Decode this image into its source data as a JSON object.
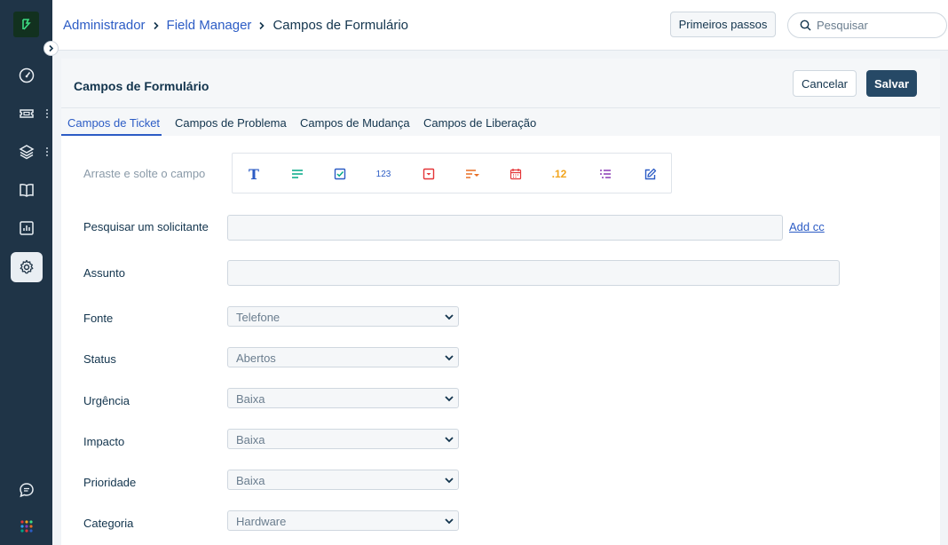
{
  "header": {
    "breadcrumb": [
      "Administrador",
      "Field Manager",
      "Campos de Formulário"
    ],
    "first_steps_label": "Primeiros passos",
    "search_placeholder": "Pesquisar"
  },
  "sidebar": {
    "items": [
      {
        "name": "dashboard",
        "icon": "gauge-icon"
      },
      {
        "name": "tickets",
        "icon": "ticket-icon"
      },
      {
        "name": "assets",
        "icon": "layers-icon"
      },
      {
        "name": "knowledge-base",
        "icon": "book-icon"
      },
      {
        "name": "reports",
        "icon": "bar-chart-icon"
      },
      {
        "name": "admin",
        "icon": "gear-icon",
        "active": true
      }
    ],
    "bottom": [
      {
        "name": "chat",
        "icon": "chat-icon"
      },
      {
        "name": "apps",
        "icon": "apps-grid-icon"
      }
    ]
  },
  "page": {
    "title": "Campos de Formulário",
    "cancel_label": "Cancelar",
    "save_label": "Salvar"
  },
  "tabs": [
    {
      "label": "Campos de Ticket",
      "active": true
    },
    {
      "label": "Campos de Problema"
    },
    {
      "label": "Campos de Mudança"
    },
    {
      "label": "Campos de Liberação"
    }
  ],
  "palette": {
    "label": "Arraste e solte o campo",
    "tools": [
      {
        "icon": "text-icon",
        "glyph": "T",
        "color": "#2c5cc5"
      },
      {
        "icon": "paragraph-icon",
        "color": "#00a886"
      },
      {
        "icon": "checkbox-icon",
        "color": "#2c5cc5"
      },
      {
        "icon": "number-icon",
        "glyph": "123",
        "color": "#2c5cc5"
      },
      {
        "icon": "dropdown-icon",
        "color": "#e43538"
      },
      {
        "icon": "dependent-field-icon",
        "color": "#e86f25"
      },
      {
        "icon": "date-icon",
        "color": "#e43538"
      },
      {
        "icon": "decimal-icon",
        "glyph": ".12",
        "color": "#f2a41c"
      },
      {
        "icon": "multi-select-icon",
        "color": "#8b3ab5"
      },
      {
        "icon": "edit-icon",
        "color": "#2c5cc5"
      }
    ]
  },
  "form": {
    "requester_label": "Pesquisar um solicitante",
    "add_cc": "Add cc",
    "subject_label": "Assunto",
    "selects": [
      {
        "label": "Fonte",
        "value": "Telefone"
      },
      {
        "label": "Status",
        "value": "Abertos"
      },
      {
        "label": "Urgência",
        "value": "Baixa"
      },
      {
        "label": "Impacto",
        "value": "Baixa"
      },
      {
        "label": "Prioridade",
        "value": "Baixa"
      },
      {
        "label": "Categoria",
        "value": "Hardware"
      }
    ]
  },
  "colors": {
    "sidebar": "#1f3447",
    "accent": "#2c5cc5",
    "primary_button": "#264966"
  }
}
